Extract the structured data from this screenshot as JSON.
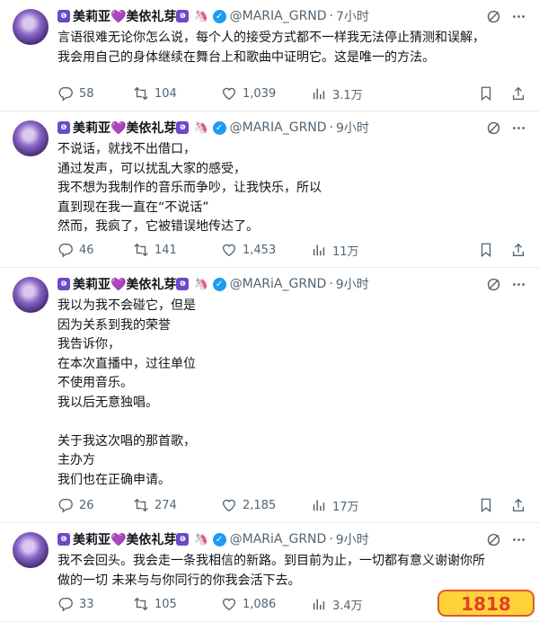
{
  "tweets": [
    {
      "name": "美莉亚💜美依礼芽",
      "name_prefix": "ə",
      "name_suffix": "ə",
      "handle": "@MARIA_GRND",
      "time": "7小时",
      "text": "言语很难无论你怎么说，每个人的接受方式都不一样我无法停止猜测和误解，\n我会用自己的身体继续在舞台上和歌曲中证明它。这是唯一的方法。",
      "replies": "58",
      "retweets": "104",
      "likes": "1,039",
      "views": "3.1万"
    },
    {
      "name": "美莉亚💜美依礼芽",
      "name_prefix": "ə",
      "name_suffix": "ə",
      "handle": "@MARIA_GRND",
      "time": "9小时",
      "text": "不说话，就找不出借口，\n通过发声，可以扰乱大家的感受，\n我不想为我制作的音乐而争吵，让我快乐，所以\n直到现在我一直在“不说话”\n然而，我疯了，它被错误地传达了。",
      "replies": "46",
      "retweets": "141",
      "likes": "1,453",
      "views": "11万"
    },
    {
      "name": "美莉亚💜美依礼芽",
      "name_prefix": "ə",
      "name_suffix": "ə",
      "handle": "@MARiA_GRND",
      "time": "9小时",
      "text": "我以为我不会碰它，但是\n因为关系到我的荣誉\n我告诉你，\n在本次直播中，过往单位\n不使用音乐。\n我以后无意独唱。\n\n关于我这次唱的那首歌，\n主办方\n我们也在正确申请。",
      "replies": "26",
      "retweets": "274",
      "likes": "2,185",
      "views": "17万"
    },
    {
      "name": "美莉亚💜美依礼芽",
      "name_prefix": "ə",
      "name_suffix": "ə",
      "handle": "@MARiA_GRND",
      "time": "9小时",
      "text": "我不会回头。我会走一条我相信的新路。到目前为止，一切都有意义谢谢你所\n做的一切 未来与与你同行的你我会活下去。",
      "replies": "33",
      "retweets": "105",
      "likes": "1,086",
      "views": "3.4万"
    }
  ],
  "watermark": "1818",
  "colors": {
    "verified": "#1d9bf0",
    "muted": "#536471",
    "accent_purple": "#6d48c7"
  }
}
